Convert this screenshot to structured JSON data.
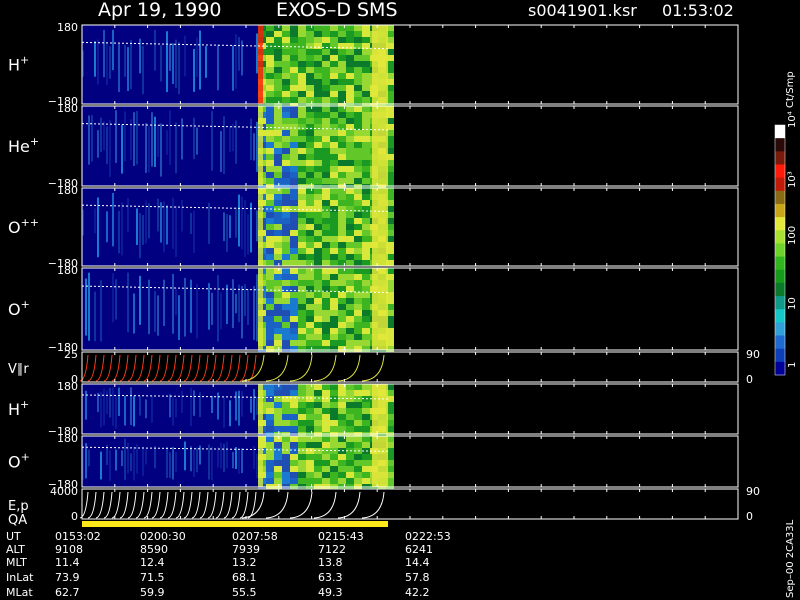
{
  "header": {
    "date": "Apr 19, 1990",
    "instrument": "EXOS–D SMS",
    "file": "s0041901.ksr",
    "time": "01:53:02"
  },
  "colorbar": {
    "unit_label": "Ct/Smp",
    "tick_labels": [
      "1",
      "10",
      "100",
      "10³",
      "10⁴"
    ],
    "colors": [
      "#000099",
      "#0d3fb8",
      "#1f6ad0",
      "#2fa0d8",
      "#16c7c7",
      "#0f9a8a",
      "#0a7a2a",
      "#169a1c",
      "#33b51f",
      "#6ed22a",
      "#a8e032",
      "#e3e83a",
      "#c9a617",
      "#8a6a12",
      "#c21a0a",
      "#ff1a0a",
      "#7a1a0a",
      "#2a0a08",
      "#ffffff"
    ]
  },
  "footer": {
    "stamp": "Sep–00 2CA33L"
  },
  "chart_data": {
    "type": "heatmap",
    "panels": [
      {
        "name": "H",
        "sup": "+",
        "ymax": "180",
        "ymin": "−180",
        "kind": "spectrogram"
      },
      {
        "name": "He",
        "sup": "+",
        "ymax": "180",
        "ymin": "−180",
        "kind": "spectrogram"
      },
      {
        "name": "O",
        "sup": "++",
        "ymax": "180",
        "ymin": "−180",
        "kind": "spectrogram"
      },
      {
        "name": "O",
        "sup": "+",
        "ymax": "180",
        "ymin": "−180",
        "kind": "spectrogram"
      },
      {
        "name": "V∥r",
        "sup": "",
        "ymax": "25",
        "ymin": "0",
        "kind": "velocity",
        "right_top": "90",
        "right_bottom": "0"
      },
      {
        "name": "H",
        "sup": "+",
        "ymax": "180",
        "ymin": "−180",
        "kind": "spectrogram"
      },
      {
        "name": "O",
        "sup": "+",
        "ymax": "180",
        "ymin": "−180",
        "kind": "spectrogram"
      },
      {
        "name": "E,p",
        "sup": "",
        "ymax": "4000",
        "ymin": "0",
        "kind": "energy",
        "right_top": "90",
        "right_bottom": "0"
      }
    ],
    "qa_label": "QA",
    "x_ticks": [
      {
        "UT": "0153:02",
        "ALT": "9108",
        "MLT": "11.4",
        "InLat": "73.9",
        "MLat": "62.7"
      },
      {
        "UT": "0200:30",
        "ALT": "8590",
        "MLT": "12.4",
        "InLat": "71.5",
        "MLat": "59.9"
      },
      {
        "UT": "0207:58",
        "ALT": "7939",
        "MLT": "13.2",
        "InLat": "68.1",
        "MLat": "55.5"
      },
      {
        "UT": "0215:43",
        "ALT": "7122",
        "MLT": "13.8",
        "InLat": "63.3",
        "MLat": "49.3"
      },
      {
        "UT": "0222:53",
        "ALT": "6241",
        "MLT": "14.4",
        "InLat": "57.8",
        "MLat": "42.2"
      }
    ],
    "row_labels": [
      "UT",
      "ALT",
      "MLT",
      "InLat",
      "MLat"
    ]
  }
}
